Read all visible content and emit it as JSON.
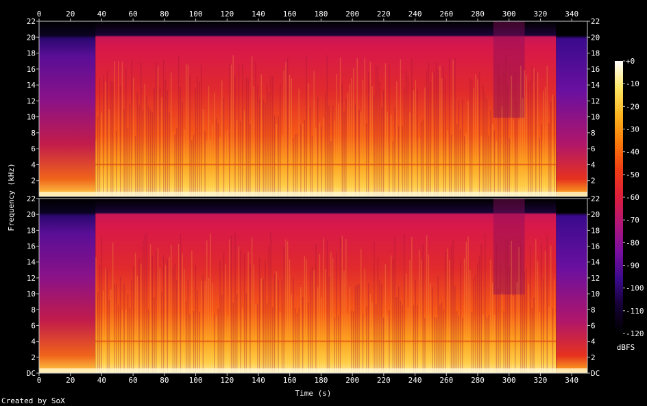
{
  "credit": "Created by SoX",
  "chart_data": {
    "type": "heatmap",
    "xlabel": "Time (s)",
    "ylabel": "Frequency (kHz)",
    "xlim": [
      0,
      350
    ],
    "x_ticks": [
      0,
      20,
      40,
      60,
      80,
      100,
      120,
      140,
      160,
      180,
      200,
      220,
      240,
      260,
      280,
      300,
      320,
      340
    ],
    "channels": [
      {
        "ylim": [
          0,
          22
        ],
        "y_ticks": [
          {
            "value": 22,
            "label": "22"
          },
          {
            "value": 20,
            "label": "20"
          },
          {
            "value": 18,
            "label": "18"
          },
          {
            "value": 16,
            "label": "16"
          },
          {
            "value": 14,
            "label": "14"
          },
          {
            "value": 12,
            "label": "12"
          },
          {
            "value": 10,
            "label": "10"
          },
          {
            "value": 8,
            "label": "8"
          },
          {
            "value": 6,
            "label": "6"
          },
          {
            "value": 4,
            "label": "4"
          },
          {
            "value": 2,
            "label": "2"
          }
        ]
      },
      {
        "ylim": [
          0,
          22
        ],
        "y_ticks": [
          {
            "value": 22,
            "label": "22"
          },
          {
            "value": 20,
            "label": "20"
          },
          {
            "value": 18,
            "label": "18"
          },
          {
            "value": 16,
            "label": "16"
          },
          {
            "value": 14,
            "label": "14"
          },
          {
            "value": 12,
            "label": "12"
          },
          {
            "value": 10,
            "label": "10"
          },
          {
            "value": 8,
            "label": "8"
          },
          {
            "value": 6,
            "label": "6"
          },
          {
            "value": 4,
            "label": "4"
          },
          {
            "value": 2,
            "label": "2"
          },
          {
            "value": 0,
            "label": "DC"
          }
        ]
      }
    ],
    "colorbar": {
      "label": "dBFS",
      "range": [
        -120,
        0
      ],
      "ticks": [
        {
          "value": 0,
          "label": "+0"
        },
        {
          "value": -10,
          "label": "-10"
        },
        {
          "value": -20,
          "label": "-20"
        },
        {
          "value": -30,
          "label": "-30"
        },
        {
          "value": -40,
          "label": "-40"
        },
        {
          "value": -50,
          "label": "-50"
        },
        {
          "value": -60,
          "label": "-60"
        },
        {
          "value": -70,
          "label": "-70"
        },
        {
          "value": -80,
          "label": "-80"
        },
        {
          "value": -90,
          "label": "-90"
        },
        {
          "value": -100,
          "label": "-100"
        },
        {
          "value": -110,
          "label": "-110"
        },
        {
          "value": -120,
          "label": "-120"
        }
      ],
      "colors": [
        "#000000",
        "#140032",
        "#3a0a8c",
        "#7a0ea0",
        "#b0167a",
        "#dc1e3c",
        "#f03c14",
        "#fa7a0a",
        "#feb41e",
        "#ffe664",
        "#ffffff"
      ]
    },
    "intensity_profile": {
      "description_levels_dbfs": true,
      "segments_s": [
        {
          "start": 0,
          "end": 36,
          "level": "quiet"
        },
        {
          "start": 36,
          "end": 330,
          "level": "loud"
        },
        {
          "start": 290,
          "end": 310,
          "level": "dip"
        },
        {
          "start": 330,
          "end": 350,
          "level": "fade"
        }
      ],
      "cutoff_khz": 20
    }
  }
}
